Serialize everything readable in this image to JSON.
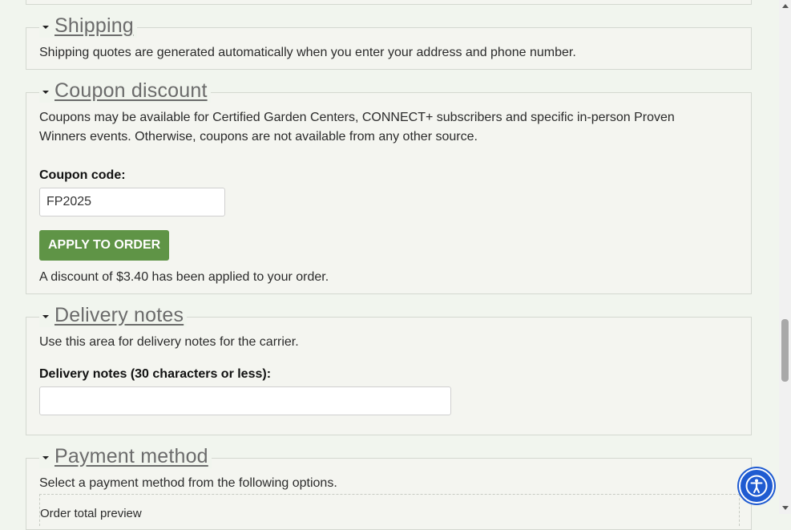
{
  "shipping": {
    "legend": "Shipping",
    "description": "Shipping quotes are generated automatically when you enter your address and phone number."
  },
  "coupon": {
    "legend": "Coupon discount",
    "description": "Coupons may be available for Certified Garden Centers, CONNECT+ subscribers and specific in-person Proven Winners events. Otherwise, coupons are not available from any other source.",
    "code_label": "Coupon code:",
    "code_value": "FP2025",
    "apply_label": "APPLY TO ORDER",
    "status": "A discount of $3.40 has been applied to your order."
  },
  "delivery": {
    "legend": "Delivery notes",
    "description": "Use this area for delivery notes for the carrier.",
    "notes_label": "Delivery notes (30 characters or less):",
    "notes_value": ""
  },
  "payment": {
    "legend": "Payment method",
    "description": "Select a payment method from the following options.",
    "preview_label": "Order total preview"
  },
  "accessibility": {
    "icon": "accessibility-icon",
    "color": "#1f5bd1"
  },
  "colors": {
    "button": "#5f9446",
    "background": "#f1f5ee"
  }
}
